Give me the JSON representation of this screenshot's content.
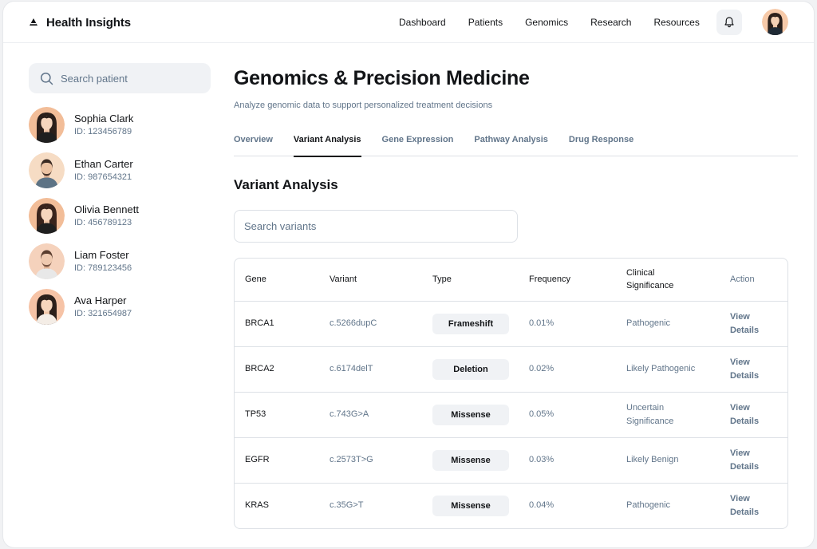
{
  "header": {
    "brand": "Health Insights",
    "nav": [
      "Dashboard",
      "Patients",
      "Genomics",
      "Research",
      "Resources"
    ]
  },
  "sidebar": {
    "search_placeholder": "Search patient",
    "patients": [
      {
        "name": "Sophia Clark",
        "id": "ID: 123456789",
        "gender": "female"
      },
      {
        "name": "Ethan Carter",
        "id": "ID: 987654321",
        "gender": "male"
      },
      {
        "name": "Olivia Bennett",
        "id": "ID: 456789123",
        "gender": "female"
      },
      {
        "name": "Liam Foster",
        "id": "ID: 789123456",
        "gender": "male"
      },
      {
        "name": "Ava Harper",
        "id": "ID: 321654987",
        "gender": "female"
      }
    ]
  },
  "main": {
    "title": "Genomics & Precision Medicine",
    "subtitle": "Analyze genomic data to support personalized treatment decisions",
    "tabs": [
      {
        "label": "Overview",
        "active": false
      },
      {
        "label": "Variant Analysis",
        "active": true
      },
      {
        "label": "Gene Expression",
        "active": false
      },
      {
        "label": "Pathway Analysis",
        "active": false
      },
      {
        "label": "Drug Response",
        "active": false
      }
    ],
    "section_title": "Variant Analysis",
    "variant_search_placeholder": "Search variants",
    "table": {
      "columns": [
        "Gene",
        "Variant",
        "Type",
        "Frequency",
        "Clinical Significance",
        "Action"
      ],
      "rows": [
        {
          "gene": "BRCA1",
          "variant": "c.5266dupC",
          "type": "Frameshift",
          "frequency": "0.01%",
          "significance": "Pathogenic",
          "action": "View Details"
        },
        {
          "gene": "BRCA2",
          "variant": "c.6174delT",
          "type": "Deletion",
          "frequency": "0.02%",
          "significance": "Likely Pathogenic",
          "action": "View Details"
        },
        {
          "gene": "TP53",
          "variant": "c.743G>A",
          "type": "Missense",
          "frequency": "0.05%",
          "significance": "Uncertain Significance",
          "action": "View Details"
        },
        {
          "gene": "EGFR",
          "variant": "c.2573T>G",
          "type": "Missense",
          "frequency": "0.03%",
          "significance": "Likely Benign",
          "action": "View Details"
        },
        {
          "gene": "KRAS",
          "variant": "c.35G>T",
          "type": "Missense",
          "frequency": "0.04%",
          "significance": "Pathogenic",
          "action": "View Details"
        }
      ]
    }
  },
  "icons": {
    "brand": "triangle-logo-icon",
    "search": "search-icon",
    "notifications": "bell-icon"
  },
  "colors": {
    "text_primary": "#121417",
    "text_secondary": "#61758a",
    "surface": "#f0f2f5",
    "border": "#dde1e6"
  }
}
